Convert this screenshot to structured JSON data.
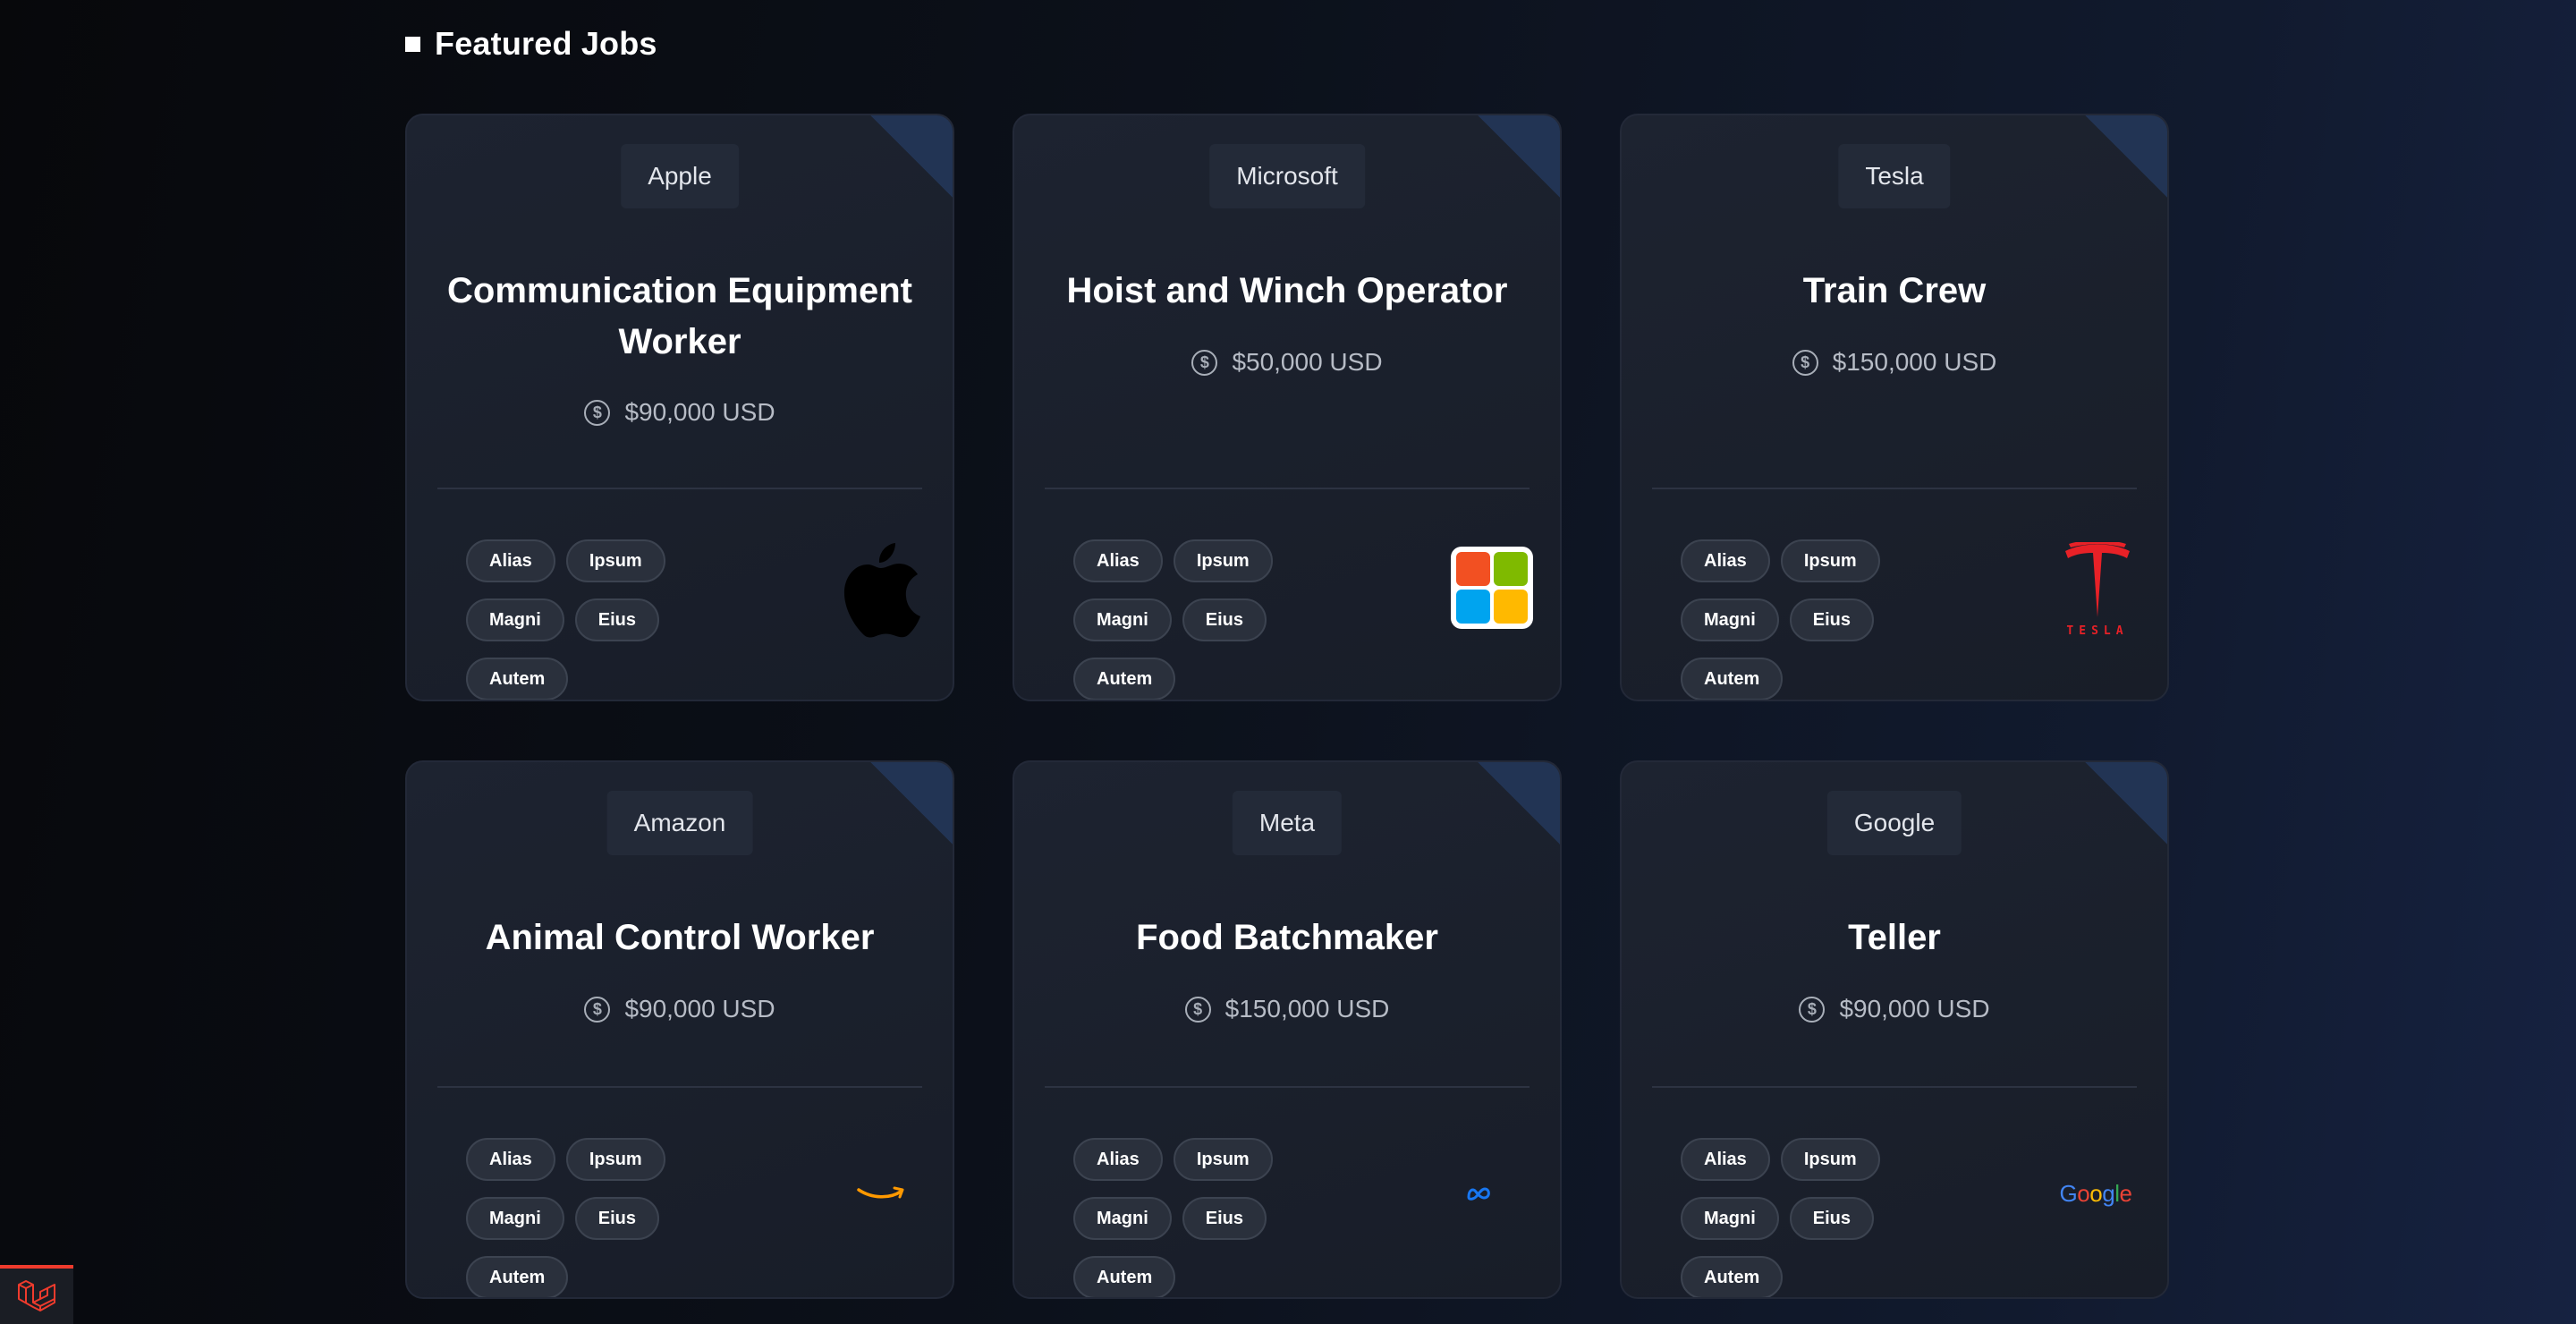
{
  "section": {
    "title": "Featured Jobs"
  },
  "jobs": [
    {
      "company": "Apple",
      "title": "Communication Equipment Worker",
      "salary": "$90,000 USD",
      "tags": [
        "Alias",
        "Ipsum",
        "Magni",
        "Eius",
        "Autem"
      ],
      "logo": "apple-logo"
    },
    {
      "company": "Microsoft",
      "title": "Hoist and Winch Operator",
      "salary": "$50,000 USD",
      "tags": [
        "Alias",
        "Ipsum",
        "Magni",
        "Eius",
        "Autem"
      ],
      "logo": "microsoft-logo"
    },
    {
      "company": "Tesla",
      "title": "Train Crew",
      "salary": "$150,000 USD",
      "tags": [
        "Alias",
        "Ipsum",
        "Magni",
        "Eius",
        "Autem"
      ],
      "logo": "tesla-logo",
      "logo_text": "TESLA"
    },
    {
      "company": "Amazon",
      "title": "Animal Control Worker",
      "salary": "$90,000 USD",
      "tags": [
        "Alias",
        "Ipsum",
        "Magni",
        "Eius",
        "Autem"
      ],
      "logo": "amazon-logo"
    },
    {
      "company": "Meta",
      "title": "Food Batchmaker",
      "salary": "$150,000 USD",
      "tags": [
        "Alias",
        "Ipsum",
        "Magni",
        "Eius",
        "Autem"
      ],
      "logo": "meta-logo"
    },
    {
      "company": "Google",
      "title": "Teller",
      "salary": "$90,000 USD",
      "tags": [
        "Alias",
        "Ipsum",
        "Magni",
        "Eius",
        "Autem"
      ],
      "logo": "google-logo",
      "logo_text": "Google"
    }
  ],
  "colors": {
    "background": "#0c111b",
    "card": "#1b202b",
    "accent_corner": "#223454",
    "tesla_red": "#e82127",
    "laravel_red": "#ef3b2d"
  },
  "debug_tab": {
    "icon": "laravel-icon"
  }
}
